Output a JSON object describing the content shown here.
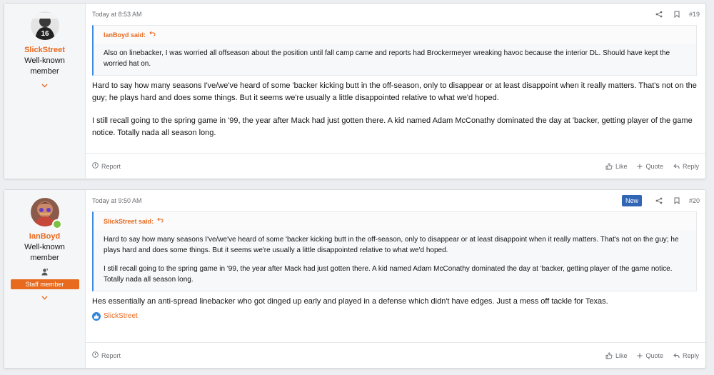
{
  "posts": [
    {
      "author": "SlickStreet",
      "user_title": "Well-known member",
      "avatar_text": "16",
      "date": "Today at 8:53 AM",
      "post_number": "#19",
      "quote": {
        "author_label": "IanBoyd said:",
        "paragraphs": [
          "Also on linebacker, I was worried all offseason about the position until fall camp came and reports had Brockermeyer wreaking havoc because the interior DL. Should have kept the worried hat on."
        ]
      },
      "paragraphs": [
        "Hard to say how many seasons I've/we've heard of some 'backer kicking butt in the off-season, only to disappear or at least disappoint when it really matters. That's not on the guy; he plays hard and does some things. But it seems we're usually a little disappointed relative to what we'd hoped.",
        "I still recall going to the spring game in '99, the year after Mack had just gotten there. A kid named Adam McConathy dominated the day at 'backer, getting player of the game notice. Totally nada all season long."
      ],
      "footer": {
        "report": "Report",
        "like": "Like",
        "quote": "Quote",
        "reply": "Reply"
      }
    },
    {
      "author": "IanBoyd",
      "user_title": "Well-known member",
      "staff_badge": "Staff member",
      "date": "Today at 9:50 AM",
      "new_badge": "New",
      "post_number": "#20",
      "quote": {
        "author_label": "SlickStreet said:",
        "paragraphs": [
          "Hard to say how many seasons I've/we've heard of some 'backer kicking butt in the off-season, only to disappear or at least disappoint when it really matters. That's not on the guy; he plays hard and does some things. But it seems we're usually a little disappointed relative to what we'd hoped.",
          "I still recall going to the spring game in '99, the year after Mack had just gotten there. A kid named Adam McConathy dominated the day at 'backer, getting player of the game notice. Totally nada all season long."
        ]
      },
      "paragraphs": [
        "Hes essentially an anti-spread linebacker who got dinged up early and played in a defense which didn't have edges. Just a mess off tackle for Texas."
      ],
      "reaction_user": "SlickStreet",
      "footer": {
        "report": "Report",
        "like": "Like",
        "quote": "Quote",
        "reply": "Reply"
      }
    }
  ],
  "icons": {
    "share": "share-icon",
    "bookmark": "bookmark-icon",
    "reply_arrow": "reply-arrow-icon",
    "report": "report-icon",
    "like": "thumbs-up-icon",
    "quote": "plus-icon",
    "reply": "reply-icon",
    "chevron": "chevron-down-icon",
    "online": "online-status-icon",
    "moderator": "moderator-icon"
  },
  "colors": {
    "accent": "#e86a1f",
    "quote_border": "#3d8be0",
    "new_badge": "#3166b5",
    "online": "#7bc043",
    "reaction": "#2f86d8"
  }
}
